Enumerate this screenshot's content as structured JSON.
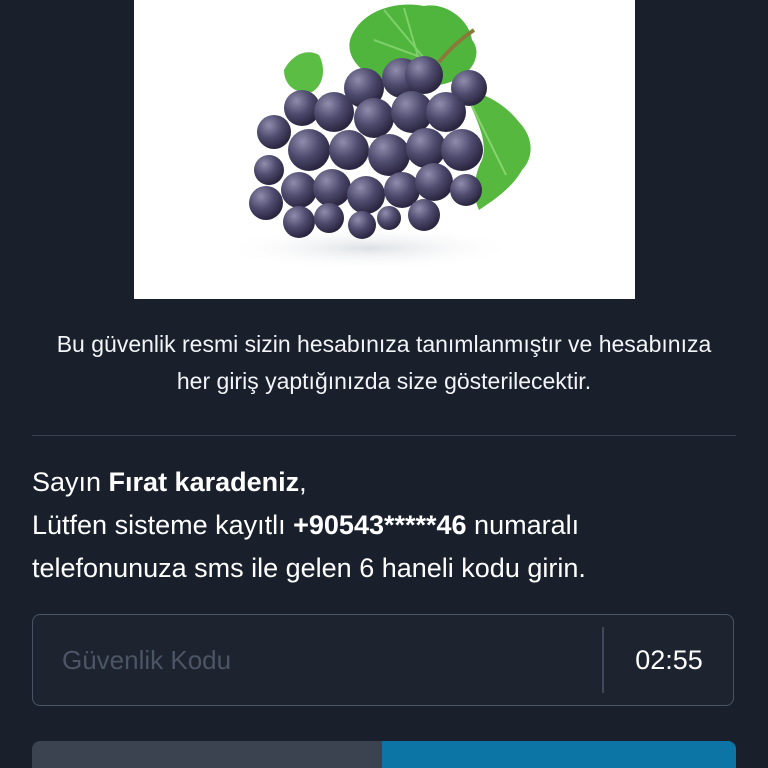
{
  "security_image": {
    "icon": "grapes-image"
  },
  "info_text": "Bu güvenlik resmi sizin hesabınıza tanımlanmıştır ve hesabınıza her giriş yaptığınızda size gösterilecektir.",
  "message": {
    "greeting": "Sayın ",
    "user_name": "Fırat karadeniz",
    "comma": ",",
    "line2_prefix": "Lütfen sisteme kayıtlı ",
    "phone": "+90543*****46",
    "line2_suffix": " numaralı",
    "line3": "telefonunuza sms ile gelen 6 haneli kodu girin."
  },
  "code_field": {
    "placeholder": "Güvenlik Kodu",
    "value": "",
    "timer": "02:55"
  },
  "colors": {
    "background": "#19202c",
    "button_secondary": "#3c4350",
    "button_primary": "#0d74a6"
  }
}
